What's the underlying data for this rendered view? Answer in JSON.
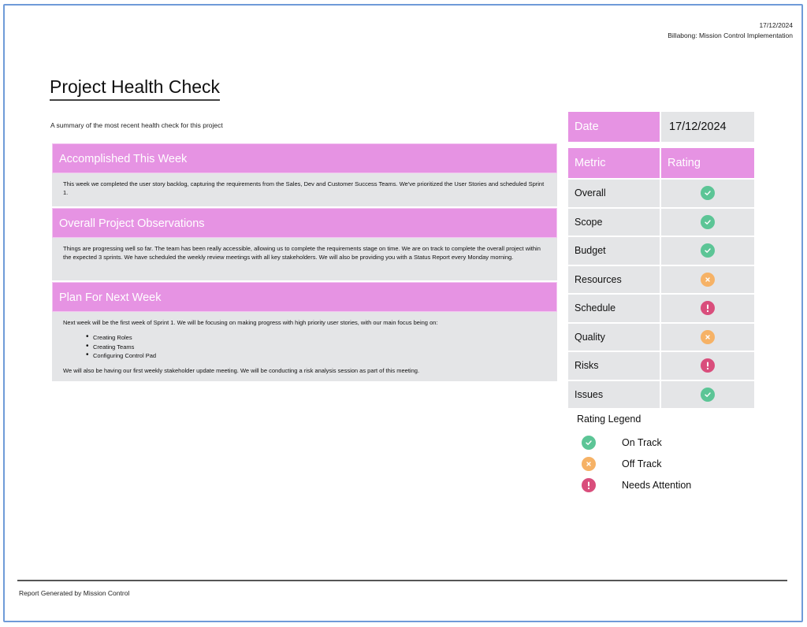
{
  "header": {
    "date": "17/12/2024",
    "project": "Billabong: Mission Control Implementation"
  },
  "title": "Project Health Check",
  "subtitle": "A summary of the most recent health check for this project",
  "sections": [
    {
      "heading": "Accomplished This Week",
      "paragraphs": [
        "This week we completed the user story backlog, capturing the requirements from the Sales, Dev and Customer Success Teams. We've prioritized the User Stories and scheduled Sprint 1."
      ]
    },
    {
      "heading": "Overall Project Observations",
      "paragraphs": [
        "Things are progressing well so far. The team has been really accessible, allowing us to complete the requirements stage on time. We are on track to complete the overall project within the expected 3 sprints. We have scheduled the weekly review meetings with all key stakeholders. We will also be providing you with a Status Report every Monday morning."
      ]
    },
    {
      "heading": "Plan For Next Week",
      "intro": "Next week will be the first week of Sprint 1. We will be focusing on making progress with high priority user stories, with our main focus being on:",
      "bullets": [
        "Creating Roles",
        "Creating Teams",
        "Configuring Control Pad"
      ],
      "outro": "We will also be having our first weekly stakeholder update meeting. We will be conducting a risk analysis session as part of this meeting."
    }
  ],
  "health_table": {
    "date_label": "Date",
    "date_value": "17/12/2024",
    "metric_header": "Metric",
    "rating_header": "Rating",
    "rows": [
      {
        "metric": "Overall",
        "rating": "on-track"
      },
      {
        "metric": "Scope",
        "rating": "on-track"
      },
      {
        "metric": "Budget",
        "rating": "on-track"
      },
      {
        "metric": "Resources",
        "rating": "off-track"
      },
      {
        "metric": "Schedule",
        "rating": "needs-attention"
      },
      {
        "metric": "Quality",
        "rating": "off-track"
      },
      {
        "metric": "Risks",
        "rating": "needs-attention"
      },
      {
        "metric": "Issues",
        "rating": "on-track"
      }
    ]
  },
  "legend": {
    "title": "Rating Legend",
    "items": [
      {
        "key": "on-track",
        "label": "On Track",
        "icon": "check-circle-icon",
        "color": "#5cc596"
      },
      {
        "key": "off-track",
        "label": "Off Track",
        "icon": "x-circle-icon",
        "color": "#f6b266"
      },
      {
        "key": "needs-attention",
        "label": "Needs Attention",
        "icon": "exclamation-circle-icon",
        "color": "#d94e7c"
      }
    ]
  },
  "colors": {
    "header_pink": "#e693e3",
    "cell_gray": "#e4e5e7",
    "page_border": "#6f9bd8"
  },
  "footer": {
    "text": "Report Generated by Mission Control"
  }
}
